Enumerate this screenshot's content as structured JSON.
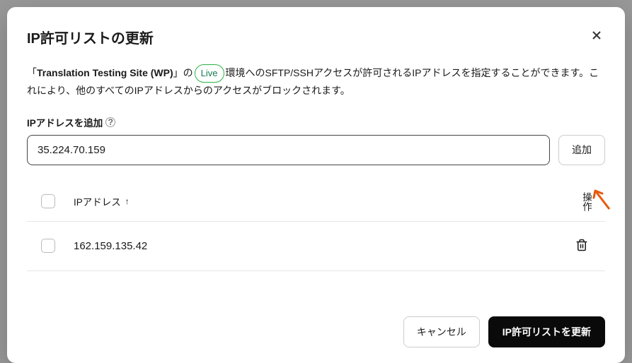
{
  "modal": {
    "title": "IP許可リストの更新",
    "description_prefix": "「",
    "site_name": "Translation Testing Site (WP)",
    "description_mid1": "」の",
    "env_badge": "Live",
    "description_mid2": "環境へのSFTP/SSHアクセスが許可されるIPアドレスを指定することができます。これにより、他のすべてのIPアドレスからのアクセスがブロックされます。",
    "add_section_label": "IPアドレスを追加",
    "help_glyph": "?",
    "input_value": "35.224.70.159",
    "add_button": "追加",
    "table": {
      "header_ip": "IPアドレス",
      "sort_glyph": "↑",
      "header_actions": "操作",
      "rows": [
        {
          "ip": "162.159.135.42"
        }
      ]
    },
    "footer": {
      "cancel": "キャンセル",
      "submit": "IP許可リストを更新"
    }
  }
}
